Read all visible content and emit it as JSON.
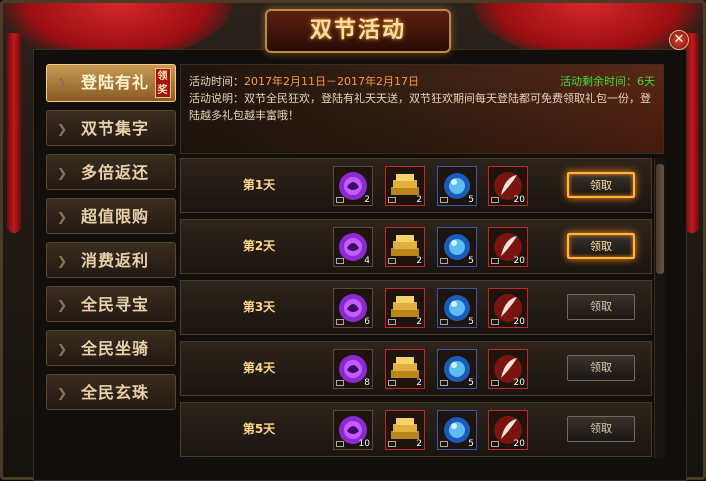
{
  "title": "双节活动",
  "close_glyph": "✕",
  "sidebar": [
    {
      "label": "登陆有礼",
      "active": true,
      "badge": "领奖"
    },
    {
      "label": "双节集字"
    },
    {
      "label": "多倍返还"
    },
    {
      "label": "超值限购"
    },
    {
      "label": "消费返利"
    },
    {
      "label": "全民寻宝"
    },
    {
      "label": "全民坐骑"
    },
    {
      "label": "全民玄珠"
    }
  ],
  "banner": {
    "time_prefix": "活动时间：",
    "time_value": "2017年2月11日－2017年2月17日",
    "remaining": "活动剩余时间：6天",
    "desc": "活动说明：双节全民狂欢，登陆有礼天天送，双节狂欢期间每天登陆都可免费领取礼包一份，登陆越多礼包越丰富哦！"
  },
  "rows": [
    {
      "day": "第1天",
      "counts": [
        "2",
        "2",
        "5",
        "20"
      ],
      "button": "领取",
      "glow": true
    },
    {
      "day": "第2天",
      "counts": [
        "4",
        "2",
        "5",
        "20"
      ],
      "button": "领取",
      "glow": true
    },
    {
      "day": "第3天",
      "counts": [
        "6",
        "2",
        "5",
        "20"
      ],
      "button": "领取",
      "glow": false
    },
    {
      "day": "第4天",
      "counts": [
        "8",
        "2",
        "5",
        "20"
      ],
      "button": "领取",
      "glow": false
    },
    {
      "day": "第5天",
      "counts": [
        "10",
        "2",
        "5",
        "20"
      ],
      "button": "领取",
      "glow": false
    }
  ],
  "item_icons": [
    "purple-orb-icon",
    "gold-ingot-icon",
    "blue-orb-icon",
    "feather-icon"
  ]
}
